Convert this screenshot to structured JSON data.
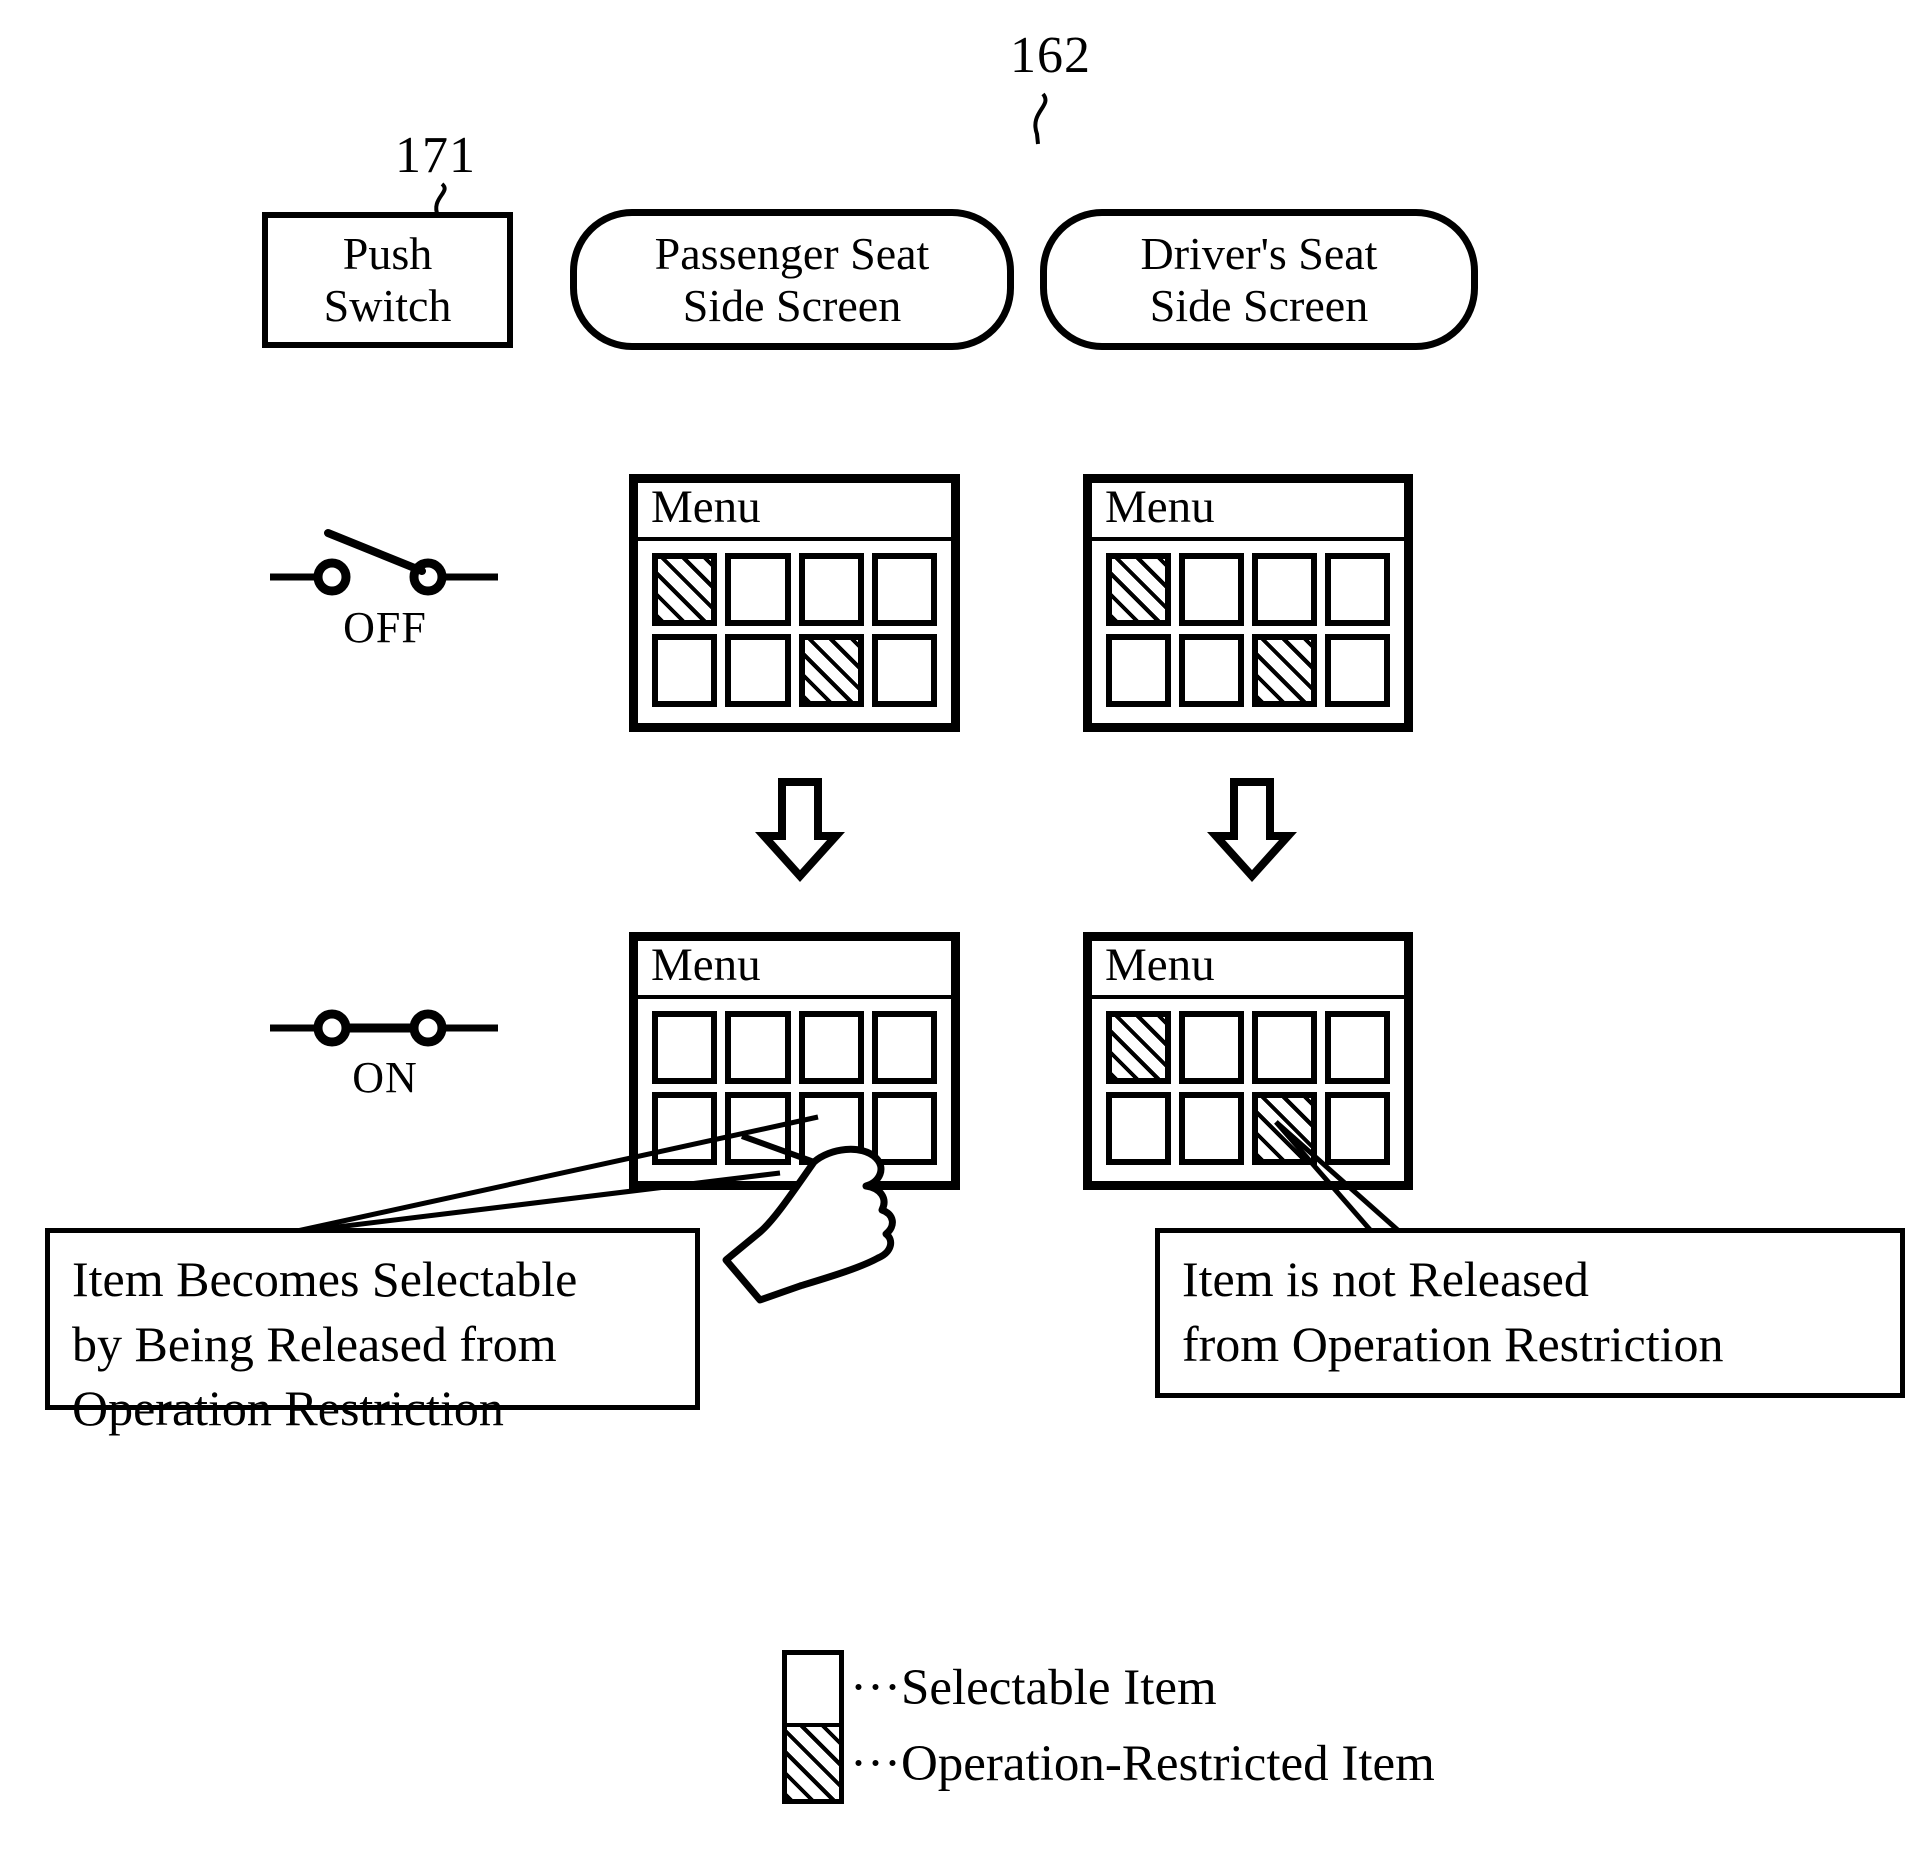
{
  "figure": {
    "ref_numerals": {
      "push_switch": "171",
      "screens_group": "162"
    }
  },
  "header": {
    "push_switch": {
      "line1": "Push",
      "line2": "Switch"
    },
    "passenger_screen": {
      "line1": "Passenger Seat",
      "line2": "Side Screen"
    },
    "driver_screen": {
      "line1": "Driver's Seat",
      "line2": "Side Screen"
    }
  },
  "switch_states": [
    {
      "label": "OFF",
      "state": "open"
    },
    {
      "label": "ON",
      "state": "closed"
    }
  ],
  "menus": {
    "title": "Menu",
    "passenger_off": {
      "title": "Menu",
      "rows": [
        [
          "restricted",
          "selectable",
          "selectable",
          "selectable"
        ],
        [
          "selectable",
          "selectable",
          "restricted",
          "selectable"
        ]
      ]
    },
    "driver_off": {
      "title": "Menu",
      "rows": [
        [
          "restricted",
          "selectable",
          "selectable",
          "selectable"
        ],
        [
          "selectable",
          "selectable",
          "restricted",
          "selectable"
        ]
      ]
    },
    "passenger_on": {
      "title": "Menu",
      "rows": [
        [
          "selectable",
          "selectable",
          "selectable",
          "selectable"
        ],
        [
          "selectable",
          "selectable",
          "selectable",
          "selectable"
        ]
      ]
    },
    "driver_on": {
      "title": "Menu",
      "rows": [
        [
          "restricted",
          "selectable",
          "selectable",
          "selectable"
        ],
        [
          "selectable",
          "selectable",
          "restricted",
          "selectable"
        ]
      ]
    }
  },
  "callouts": {
    "left": {
      "line1": "Item Becomes Selectable",
      "line2": "by Being Released from",
      "line3": "Operation Restriction"
    },
    "right": {
      "line1": "Item is not Released",
      "line2": "from Operation Restriction"
    }
  },
  "legend": {
    "selectable_label": "···Selectable Item",
    "restricted_label": "···Operation-Restricted Item"
  },
  "colors": {
    "ink": "#000000",
    "paper": "#ffffff"
  }
}
